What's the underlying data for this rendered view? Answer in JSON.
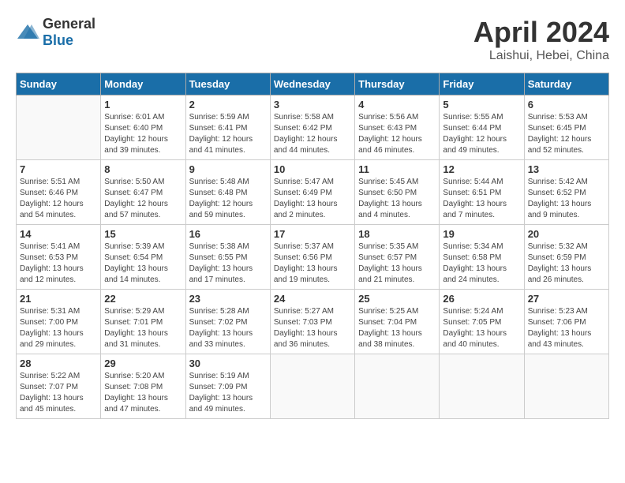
{
  "header": {
    "logo_general": "General",
    "logo_blue": "Blue",
    "month": "April 2024",
    "location": "Laishui, Hebei, China"
  },
  "days_of_week": [
    "Sunday",
    "Monday",
    "Tuesday",
    "Wednesday",
    "Thursday",
    "Friday",
    "Saturday"
  ],
  "weeks": [
    [
      {
        "day": "",
        "empty": true
      },
      {
        "day": "1",
        "sunrise": "Sunrise: 6:01 AM",
        "sunset": "Sunset: 6:40 PM",
        "daylight": "Daylight: 12 hours and 39 minutes."
      },
      {
        "day": "2",
        "sunrise": "Sunrise: 5:59 AM",
        "sunset": "Sunset: 6:41 PM",
        "daylight": "Daylight: 12 hours and 41 minutes."
      },
      {
        "day": "3",
        "sunrise": "Sunrise: 5:58 AM",
        "sunset": "Sunset: 6:42 PM",
        "daylight": "Daylight: 12 hours and 44 minutes."
      },
      {
        "day": "4",
        "sunrise": "Sunrise: 5:56 AM",
        "sunset": "Sunset: 6:43 PM",
        "daylight": "Daylight: 12 hours and 46 minutes."
      },
      {
        "day": "5",
        "sunrise": "Sunrise: 5:55 AM",
        "sunset": "Sunset: 6:44 PM",
        "daylight": "Daylight: 12 hours and 49 minutes."
      },
      {
        "day": "6",
        "sunrise": "Sunrise: 5:53 AM",
        "sunset": "Sunset: 6:45 PM",
        "daylight": "Daylight: 12 hours and 52 minutes."
      }
    ],
    [
      {
        "day": "7",
        "sunrise": "Sunrise: 5:51 AM",
        "sunset": "Sunset: 6:46 PM",
        "daylight": "Daylight: 12 hours and 54 minutes."
      },
      {
        "day": "8",
        "sunrise": "Sunrise: 5:50 AM",
        "sunset": "Sunset: 6:47 PM",
        "daylight": "Daylight: 12 hours and 57 minutes."
      },
      {
        "day": "9",
        "sunrise": "Sunrise: 5:48 AM",
        "sunset": "Sunset: 6:48 PM",
        "daylight": "Daylight: 12 hours and 59 minutes."
      },
      {
        "day": "10",
        "sunrise": "Sunrise: 5:47 AM",
        "sunset": "Sunset: 6:49 PM",
        "daylight": "Daylight: 13 hours and 2 minutes."
      },
      {
        "day": "11",
        "sunrise": "Sunrise: 5:45 AM",
        "sunset": "Sunset: 6:50 PM",
        "daylight": "Daylight: 13 hours and 4 minutes."
      },
      {
        "day": "12",
        "sunrise": "Sunrise: 5:44 AM",
        "sunset": "Sunset: 6:51 PM",
        "daylight": "Daylight: 13 hours and 7 minutes."
      },
      {
        "day": "13",
        "sunrise": "Sunrise: 5:42 AM",
        "sunset": "Sunset: 6:52 PM",
        "daylight": "Daylight: 13 hours and 9 minutes."
      }
    ],
    [
      {
        "day": "14",
        "sunrise": "Sunrise: 5:41 AM",
        "sunset": "Sunset: 6:53 PM",
        "daylight": "Daylight: 13 hours and 12 minutes."
      },
      {
        "day": "15",
        "sunrise": "Sunrise: 5:39 AM",
        "sunset": "Sunset: 6:54 PM",
        "daylight": "Daylight: 13 hours and 14 minutes."
      },
      {
        "day": "16",
        "sunrise": "Sunrise: 5:38 AM",
        "sunset": "Sunset: 6:55 PM",
        "daylight": "Daylight: 13 hours and 17 minutes."
      },
      {
        "day": "17",
        "sunrise": "Sunrise: 5:37 AM",
        "sunset": "Sunset: 6:56 PM",
        "daylight": "Daylight: 13 hours and 19 minutes."
      },
      {
        "day": "18",
        "sunrise": "Sunrise: 5:35 AM",
        "sunset": "Sunset: 6:57 PM",
        "daylight": "Daylight: 13 hours and 21 minutes."
      },
      {
        "day": "19",
        "sunrise": "Sunrise: 5:34 AM",
        "sunset": "Sunset: 6:58 PM",
        "daylight": "Daylight: 13 hours and 24 minutes."
      },
      {
        "day": "20",
        "sunrise": "Sunrise: 5:32 AM",
        "sunset": "Sunset: 6:59 PM",
        "daylight": "Daylight: 13 hours and 26 minutes."
      }
    ],
    [
      {
        "day": "21",
        "sunrise": "Sunrise: 5:31 AM",
        "sunset": "Sunset: 7:00 PM",
        "daylight": "Daylight: 13 hours and 29 minutes."
      },
      {
        "day": "22",
        "sunrise": "Sunrise: 5:29 AM",
        "sunset": "Sunset: 7:01 PM",
        "daylight": "Daylight: 13 hours and 31 minutes."
      },
      {
        "day": "23",
        "sunrise": "Sunrise: 5:28 AM",
        "sunset": "Sunset: 7:02 PM",
        "daylight": "Daylight: 13 hours and 33 minutes."
      },
      {
        "day": "24",
        "sunrise": "Sunrise: 5:27 AM",
        "sunset": "Sunset: 7:03 PM",
        "daylight": "Daylight: 13 hours and 36 minutes."
      },
      {
        "day": "25",
        "sunrise": "Sunrise: 5:25 AM",
        "sunset": "Sunset: 7:04 PM",
        "daylight": "Daylight: 13 hours and 38 minutes."
      },
      {
        "day": "26",
        "sunrise": "Sunrise: 5:24 AM",
        "sunset": "Sunset: 7:05 PM",
        "daylight": "Daylight: 13 hours and 40 minutes."
      },
      {
        "day": "27",
        "sunrise": "Sunrise: 5:23 AM",
        "sunset": "Sunset: 7:06 PM",
        "daylight": "Daylight: 13 hours and 43 minutes."
      }
    ],
    [
      {
        "day": "28",
        "sunrise": "Sunrise: 5:22 AM",
        "sunset": "Sunset: 7:07 PM",
        "daylight": "Daylight: 13 hours and 45 minutes."
      },
      {
        "day": "29",
        "sunrise": "Sunrise: 5:20 AM",
        "sunset": "Sunset: 7:08 PM",
        "daylight": "Daylight: 13 hours and 47 minutes."
      },
      {
        "day": "30",
        "sunrise": "Sunrise: 5:19 AM",
        "sunset": "Sunset: 7:09 PM",
        "daylight": "Daylight: 13 hours and 49 minutes."
      },
      {
        "day": "",
        "empty": true
      },
      {
        "day": "",
        "empty": true
      },
      {
        "day": "",
        "empty": true
      },
      {
        "day": "",
        "empty": true
      }
    ]
  ]
}
